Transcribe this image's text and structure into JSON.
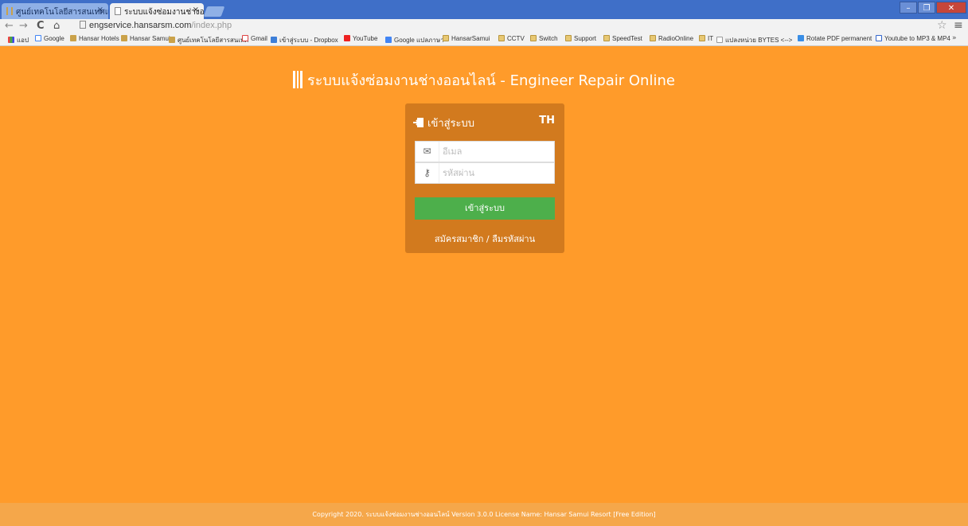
{
  "browser": {
    "tabs": [
      {
        "label": "ศูนย์เทคโนโลยีสารสนเทศและ"
      },
      {
        "label": "ระบบแจ้งซ่อมงานช่างออนไลน์"
      }
    ],
    "url_host": "engservice.hansarsm.com",
    "url_path": "/index.php",
    "bookmarks": [
      "แอป",
      "Google",
      "Hansar Hotels",
      "Hansar Samui",
      "ศูนย์เทคโนโลยีสารสนเทศ",
      "Gmail",
      "เข้าสู่ระบบ - Dropbox",
      "YouTube",
      "Google แปลภาษา",
      "HansarSamui",
      "CCTV",
      "Switch",
      "Support",
      "SpeedTest",
      "RadioOnline",
      "IT",
      "แปลงหน่วย BYTES <-->",
      "Rotate PDF permanent",
      "Youtube to MP3 & MP4"
    ],
    "more_label": "»"
  },
  "page": {
    "title": "ระบบแจ้งซ่อมงานช่างออนไลน์ - Engineer Repair Online",
    "login": {
      "heading": "เข้าสู่ระบบ",
      "lang": "TH",
      "email_placeholder": "อีเมล",
      "password_placeholder": "รหัสผ่าน",
      "submit_label": "เข้าสู่ระบบ",
      "links_label": "สมัครสมาชิก / ลืมรหัสผ่าน"
    },
    "footer": "Copyright 2020. ระบบแจ้งซ่อมงานช่างออนไลน์ Version 3.0.0 License Name: Hansar Samui Resort [Free Edition]"
  },
  "colors": {
    "background": "#ff9b2a",
    "panel": "#d27a1e",
    "button": "#4daf4b"
  }
}
